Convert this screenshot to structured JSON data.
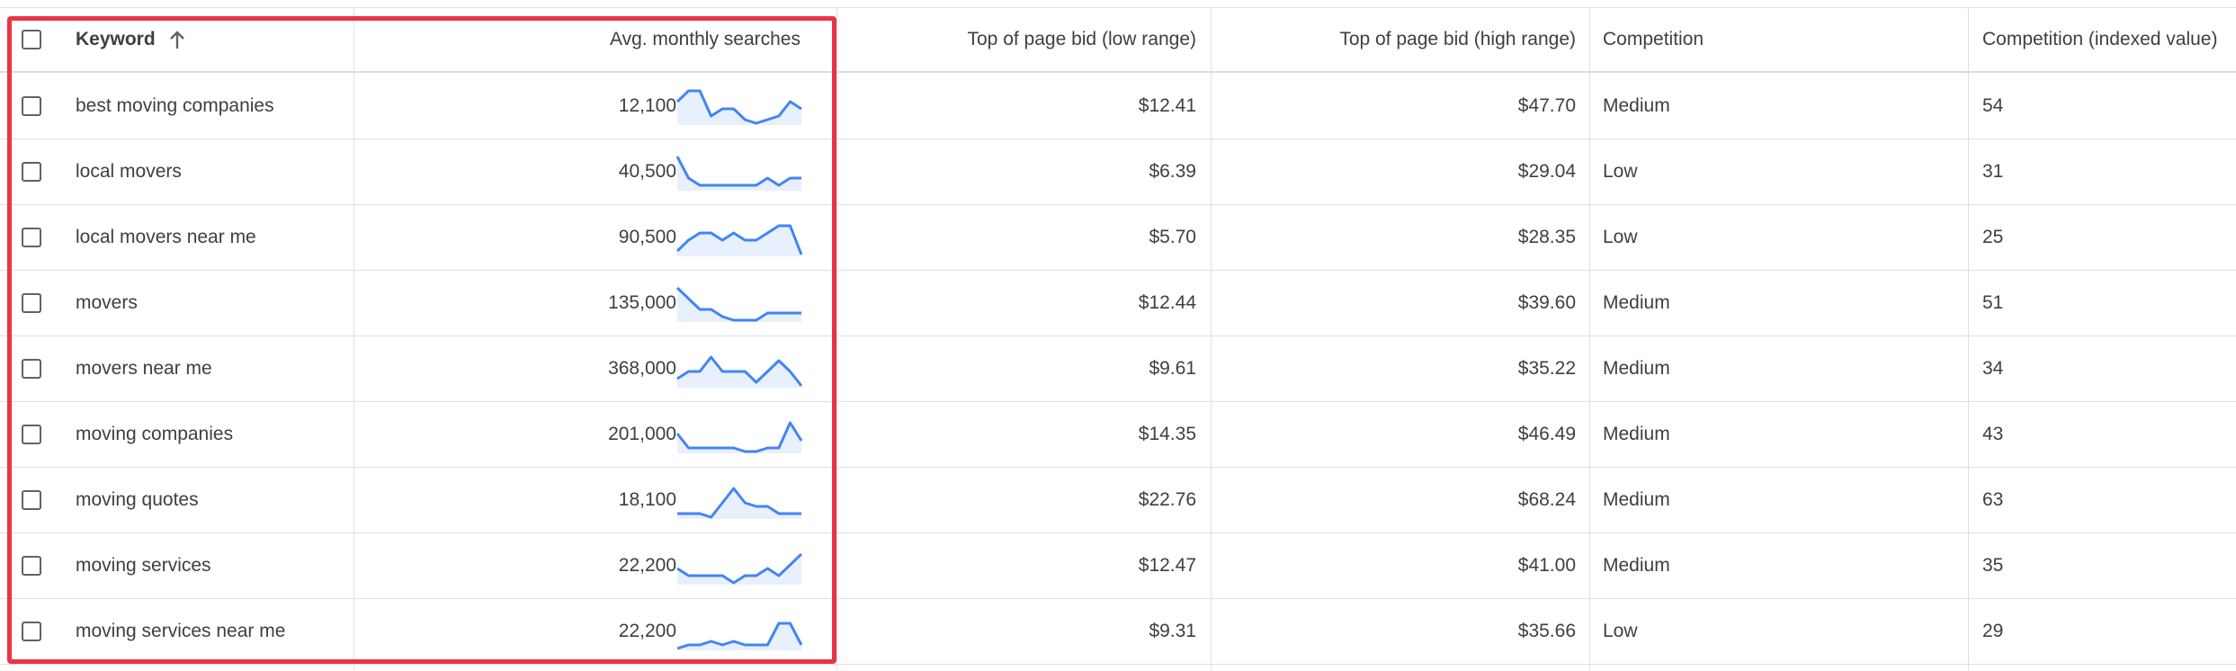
{
  "header": {
    "keyword": "Keyword",
    "avg_monthly": "Avg. monthly searches",
    "bid_low": "Top of page bid (low range)",
    "bid_high": "Top of page bid (high range)",
    "competition": "Competition",
    "competition_index": "Competition (indexed value)"
  },
  "colors": {
    "accent": "#4285f4",
    "highlight": "#ea3345",
    "trend_fill": "#e8f0fe"
  },
  "rows": [
    {
      "keyword": "best moving companies",
      "avg": "12,100",
      "low": "$12.41",
      "high": "$47.70",
      "competition": "Medium",
      "index": "54",
      "trend": [
        6,
        9,
        9,
        2,
        4,
        4,
        1,
        0,
        1,
        2,
        6,
        4
      ]
    },
    {
      "keyword": "local movers",
      "avg": "40,500",
      "low": "$6.39",
      "high": "$29.04",
      "competition": "Low",
      "index": "31",
      "trend": [
        9,
        3,
        1,
        1,
        1,
        1,
        1,
        1,
        3,
        1,
        3,
        3
      ]
    },
    {
      "keyword": "local movers near me",
      "avg": "90,500",
      "low": "$5.70",
      "high": "$28.35",
      "competition": "Low",
      "index": "25",
      "trend": [
        1,
        4,
        6,
        6,
        4,
        6,
        4,
        4,
        6,
        8,
        8,
        0
      ]
    },
    {
      "keyword": "movers",
      "avg": "135,000",
      "low": "$12.44",
      "high": "$39.60",
      "competition": "Medium",
      "index": "51",
      "trend": [
        9,
        6,
        3,
        3,
        1,
        0,
        0,
        0,
        2,
        2,
        2,
        2
      ]
    },
    {
      "keyword": "movers near me",
      "avg": "368,000",
      "low": "$9.61",
      "high": "$35.22",
      "competition": "Medium",
      "index": "34",
      "trend": [
        2,
        4,
        4,
        8,
        4,
        4,
        4,
        1,
        4,
        7,
        4,
        0
      ]
    },
    {
      "keyword": "moving companies",
      "avg": "201,000",
      "low": "$14.35",
      "high": "$46.49",
      "competition": "Medium",
      "index": "43",
      "trend": [
        5,
        1,
        1,
        1,
        1,
        1,
        0,
        0,
        1,
        1,
        8,
        3
      ]
    },
    {
      "keyword": "moving quotes",
      "avg": "18,100",
      "low": "$22.76",
      "high": "$68.24",
      "competition": "Medium",
      "index": "63",
      "trend": [
        1,
        1,
        1,
        0,
        4,
        8,
        4,
        3,
        3,
        1,
        1,
        1
      ]
    },
    {
      "keyword": "moving services",
      "avg": "22,200",
      "low": "$12.47",
      "high": "$41.00",
      "competition": "Medium",
      "index": "35",
      "trend": [
        4,
        2,
        2,
        2,
        2,
        0,
        2,
        2,
        4,
        2,
        5,
        8
      ]
    },
    {
      "keyword": "moving services near me",
      "avg": "22,200",
      "low": "$9.31",
      "high": "$35.66",
      "competition": "Low",
      "index": "29",
      "trend": [
        0,
        1,
        1,
        2,
        1,
        2,
        1,
        1,
        1,
        7,
        7,
        1
      ]
    }
  ]
}
